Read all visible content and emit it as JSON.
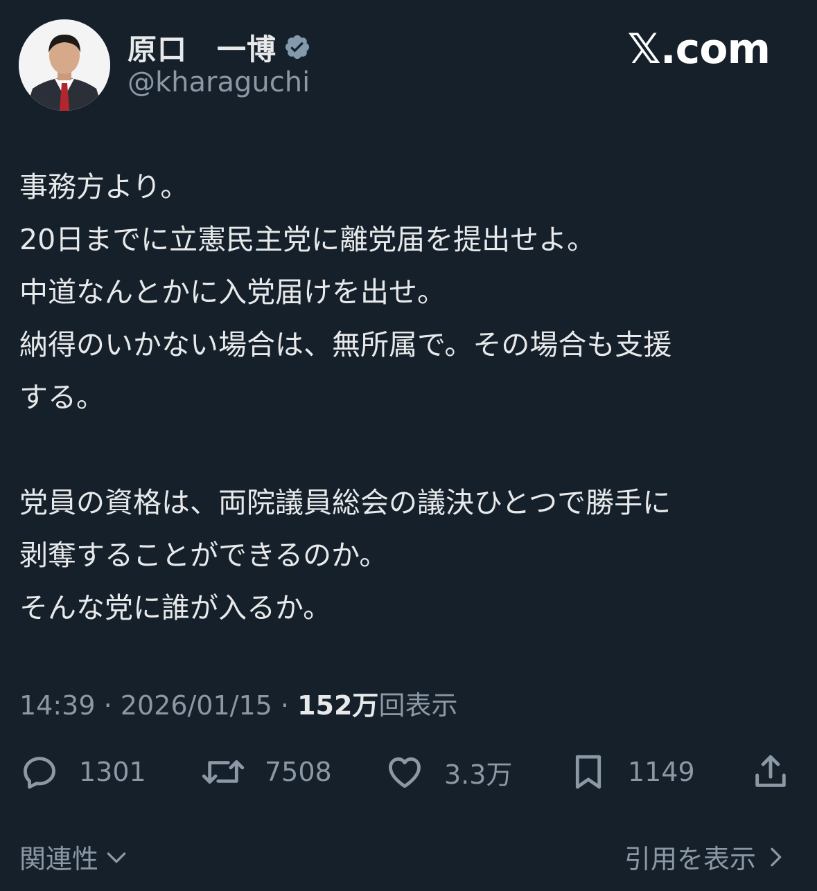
{
  "author": {
    "display_name": "原口　一博",
    "handle": "@kharaguchi",
    "verified": true
  },
  "brand": "𝕏.com",
  "tweet": {
    "lines_block1": [
      "事務方より。",
      "20日までに立憲民主党に離党届を提出せよ。",
      "中道なんとかに入党届けを出せ。",
      "納得のいかない場合は、無所属で。その場合も支援",
      "する。"
    ],
    "lines_block2": [
      "党員の資格は、両院議員総会の議決ひとつで勝手に",
      "剥奪することができるのか。",
      "そんな党に誰が入るか。"
    ]
  },
  "meta": {
    "time": "14:39",
    "separator": "·",
    "date": "2026/01/15",
    "views_count": "152万",
    "views_label": "回表示"
  },
  "actions": {
    "reply_count": "1301",
    "retweet_count": "7508",
    "like_count": "3.3万",
    "bookmark_count": "1149"
  },
  "footer": {
    "related_label": "関連性",
    "quotes_label": "引用を表示"
  },
  "colors": {
    "background": "#16202a",
    "text": "#e7e9ea",
    "muted": "#8b98a5",
    "verified_badge": "#829aab"
  }
}
